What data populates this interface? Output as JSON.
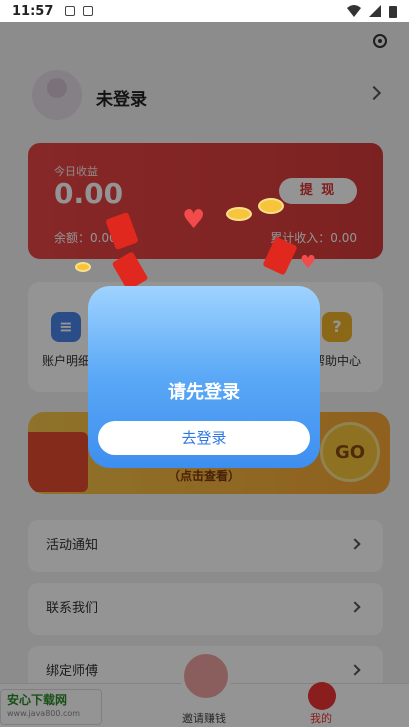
{
  "status_bar": {
    "time": "11:57"
  },
  "profile": {
    "name": "未登录"
  },
  "earnings": {
    "today_label": "今日收益",
    "today_value": "0.00",
    "withdraw_label": "提 现",
    "balance_text": "余额：0.00",
    "total_text": "累计收入：0.00"
  },
  "grid": {
    "items": [
      {
        "label": "账户明细"
      },
      {
        "label": "帮助中心"
      }
    ]
  },
  "banner": {
    "hint": "（点击查看）",
    "go_label": "GO"
  },
  "rows": [
    {
      "label": "活动通知"
    },
    {
      "label": "联系我们"
    },
    {
      "label": "绑定师傅"
    }
  ],
  "tabbar": {
    "invite_label": "邀请赚钱",
    "mine_label": "我的"
  },
  "watermark": {
    "title": "安心下载网",
    "url": "www.java800.com"
  },
  "modal": {
    "title": "请先登录",
    "button_label": "去登录"
  },
  "colors": {
    "accent_red": "#e33b3b",
    "modal_blue": "#3e8ef0",
    "banner_gold": "#f7c64a"
  }
}
